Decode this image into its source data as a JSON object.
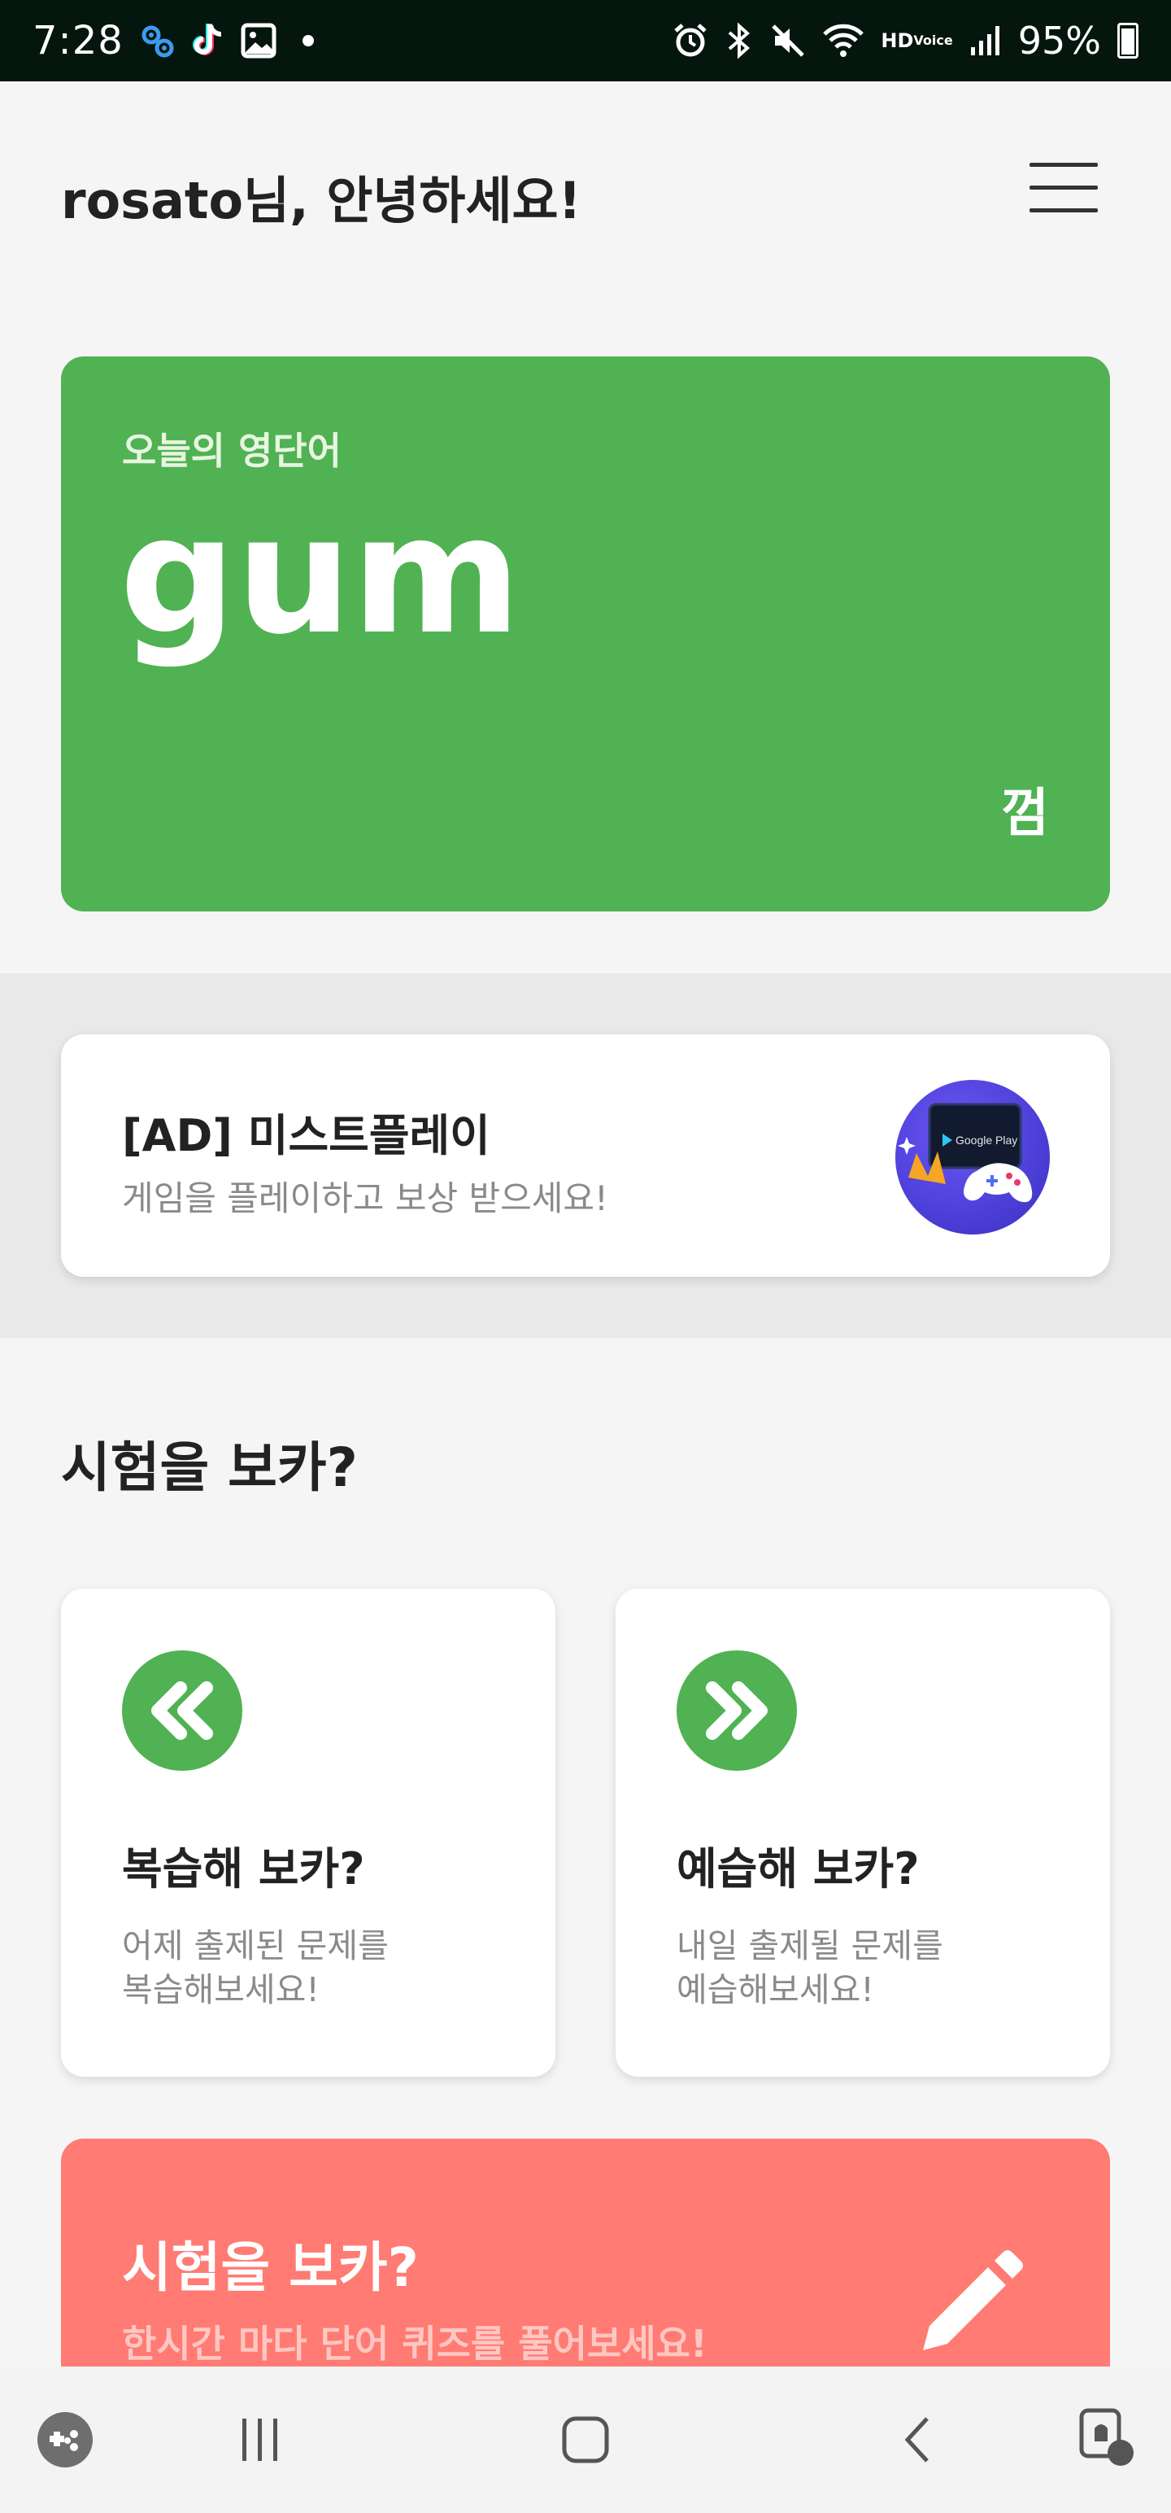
{
  "status_bar": {
    "time": "7:28",
    "battery_text": "95%",
    "hd_label_top": "HD",
    "hd_label_bottom": "Voice",
    "icons_left": [
      "settings-icon",
      "tiktok-icon",
      "gallery-icon",
      "notification-dot-icon"
    ],
    "icons_right": [
      "alarm-icon",
      "bluetooth-icon",
      "mute-icon",
      "wifi-icon",
      "signal-icon",
      "battery-icon"
    ]
  },
  "header": {
    "greeting": "rosato님, 안녕하세요!",
    "menu_icon": "hamburger-menu-icon"
  },
  "word_card": {
    "label": "오늘의 영단어",
    "word": "gum",
    "meaning": "껌",
    "color": "#50b253"
  },
  "ad": {
    "title": "[AD] 미스트플레이",
    "subtitle": "게임을 플레이하고 보상 받으세요!",
    "logo_text": "Google Play"
  },
  "section": {
    "title": "시험을 보카?"
  },
  "review_card": {
    "icon": "rewind-icon",
    "title": "복습해 보카?",
    "desc_line1": "어제 출제된 문제를",
    "desc_line2": "복습해보세요!"
  },
  "preview_card": {
    "icon": "fast-forward-icon",
    "title": "예습해 보카?",
    "desc_line1": "내일 출제될 문제를",
    "desc_line2": "예습해보세요!"
  },
  "quiz_card": {
    "title": "시험을 보카?",
    "subtitle": "한시간 마다 단어 퀴즈를 풀어보세요!",
    "icon": "pencil-icon",
    "color": "#ff7b73"
  },
  "nav_bar": {
    "items": [
      "game-launcher-icon",
      "recent-apps-icon",
      "home-icon",
      "back-icon",
      "assistant-icon"
    ]
  }
}
